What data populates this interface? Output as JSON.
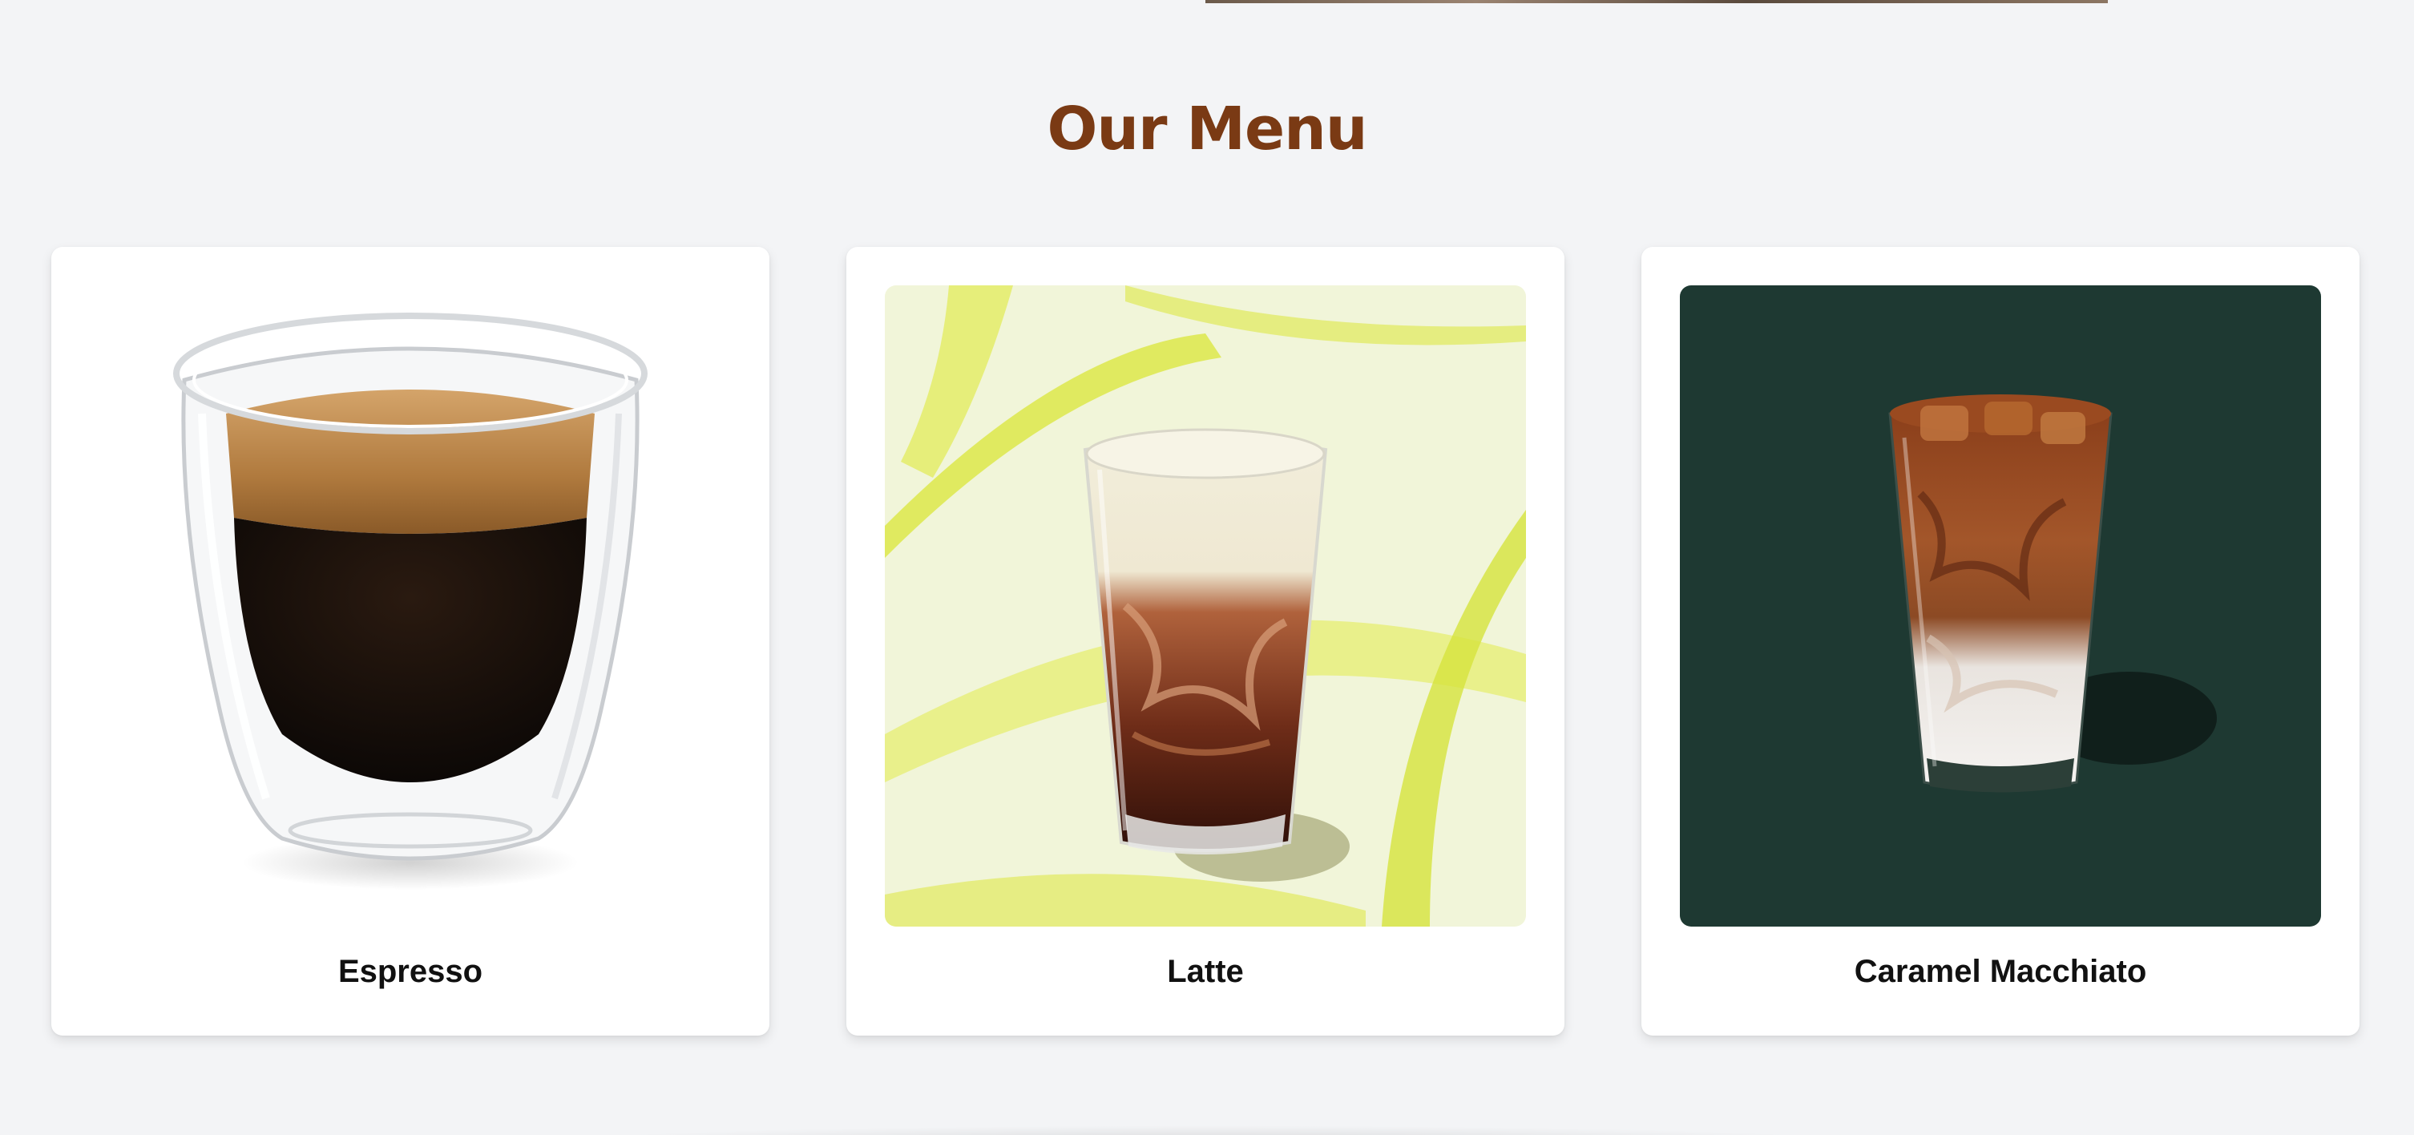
{
  "menu": {
    "title": "Our Menu",
    "items": [
      {
        "name": "Espresso",
        "image_icon": "espresso-cup-image",
        "background_color": "#ffffff"
      },
      {
        "name": "Latte",
        "image_icon": "iced-latte-image",
        "background_color": "#f0f4d6"
      },
      {
        "name": "Caramel Macchiato",
        "image_icon": "caramel-macchiato-image",
        "background_color": "#1e3932"
      }
    ]
  },
  "colors": {
    "page_background": "#f3f4f6",
    "title": "#7a3a14",
    "card_background": "#ffffff",
    "item_text": "#111111"
  }
}
